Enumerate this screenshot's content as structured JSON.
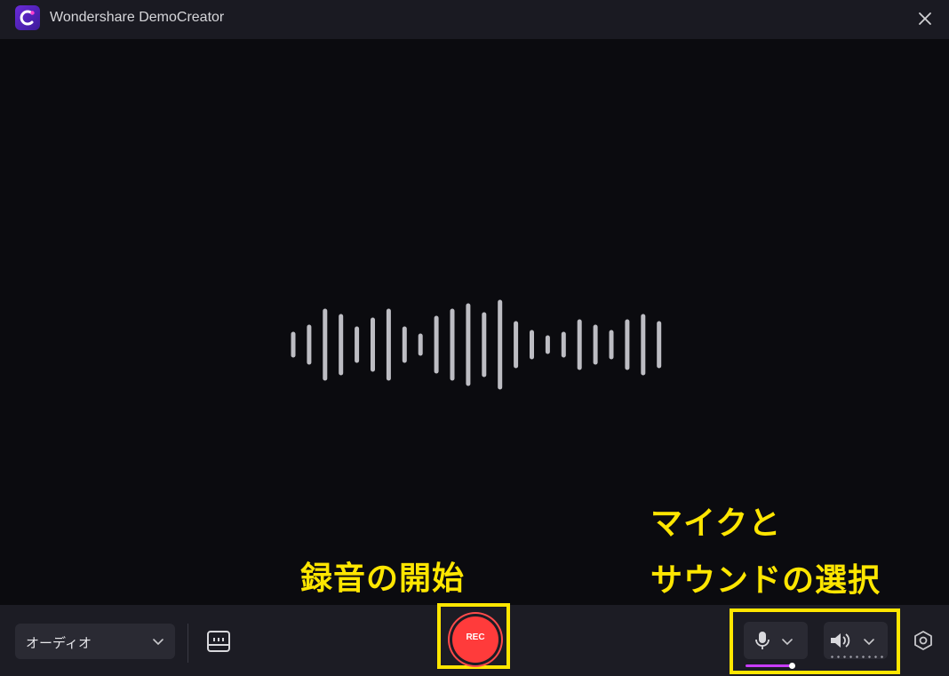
{
  "window": {
    "title": "Wondershare DemoCreator",
    "logo_icon": "democreator-logo-icon",
    "close_icon": "close-icon"
  },
  "waveform": {
    "icon": "audio-waveform-icon",
    "color": "#bdbdc3"
  },
  "annotations": {
    "start_recording": "録音の開始",
    "mic_sound_line1": "マイクと",
    "mic_sound_line2": "サウンドの選択",
    "highlight_color": "#ffe600"
  },
  "bottombar": {
    "mode_select": {
      "value": "オーディオ",
      "icon": "chevron-down-icon"
    },
    "screen_toggle_icon": "screen-capture-icon",
    "record_button": {
      "label": "REC",
      "color": "#ff3b3b"
    },
    "microphone": {
      "icon": "microphone-icon",
      "dropdown_icon": "chevron-down-icon",
      "level_color": "#c83cff"
    },
    "speaker": {
      "icon": "speaker-icon",
      "dropdown_icon": "chevron-down-icon"
    },
    "settings_icon": "settings-hexagon-icon"
  }
}
